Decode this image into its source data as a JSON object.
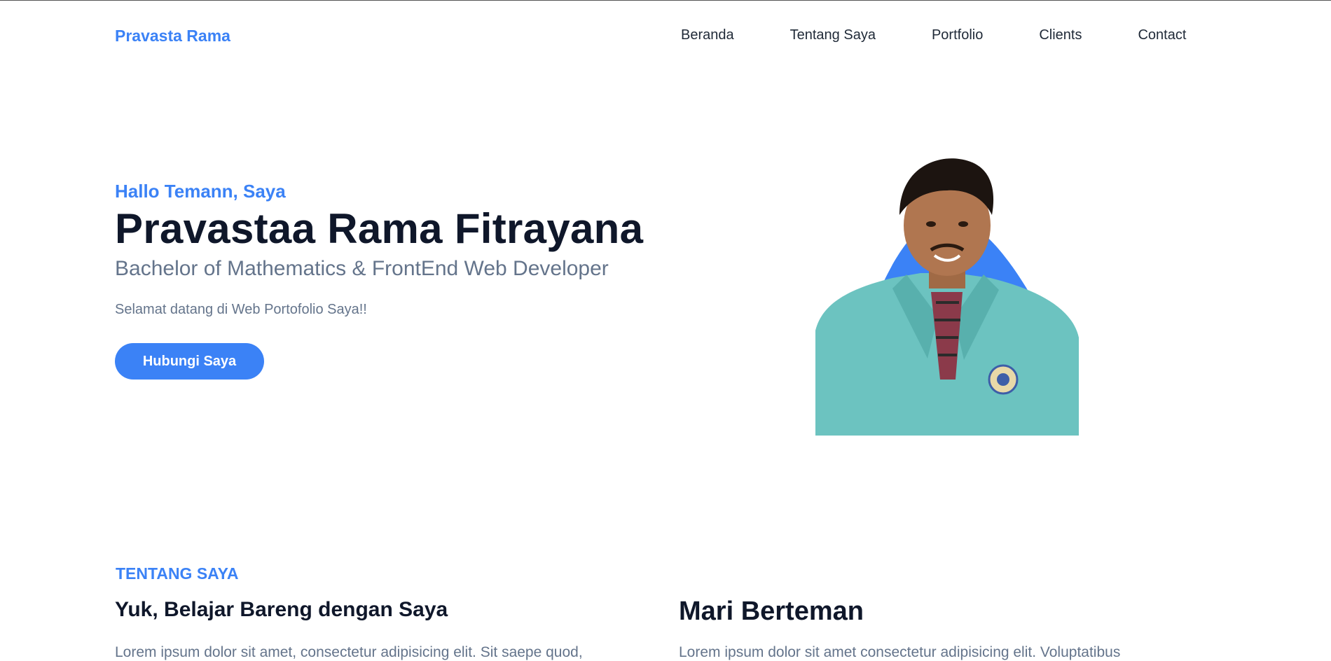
{
  "navbar": {
    "brand": "Pravasta Rama",
    "links": [
      "Beranda",
      "Tentang Saya",
      "Portfolio",
      "Clients",
      "Contact"
    ]
  },
  "hero": {
    "greeting": "Hallo Temann, Saya",
    "name": "Pravastaa Rama Fitrayana",
    "role": "Bachelor of Mathematics & FrontEnd Web Developer",
    "welcome": "Selamat datang di Web Portofolio Saya!!",
    "button_label": "Hubungi Saya",
    "photo_icon": "profile-photo"
  },
  "about": {
    "label": "TENTANG SAYA",
    "title": "Yuk, Belajar Bareng dengan Saya",
    "text": "Lorem ipsum dolor sit amet, consectetur adipisicing elit. Sit saepe quod,",
    "friend_title": "Mari Berteman",
    "friend_text": "Lorem ipsum dolor sit amet consectetur adipisicing elit. Voluptatibus"
  },
  "colors": {
    "accent": "#3b82f6",
    "heading": "#0f172a",
    "muted": "#64748b"
  }
}
